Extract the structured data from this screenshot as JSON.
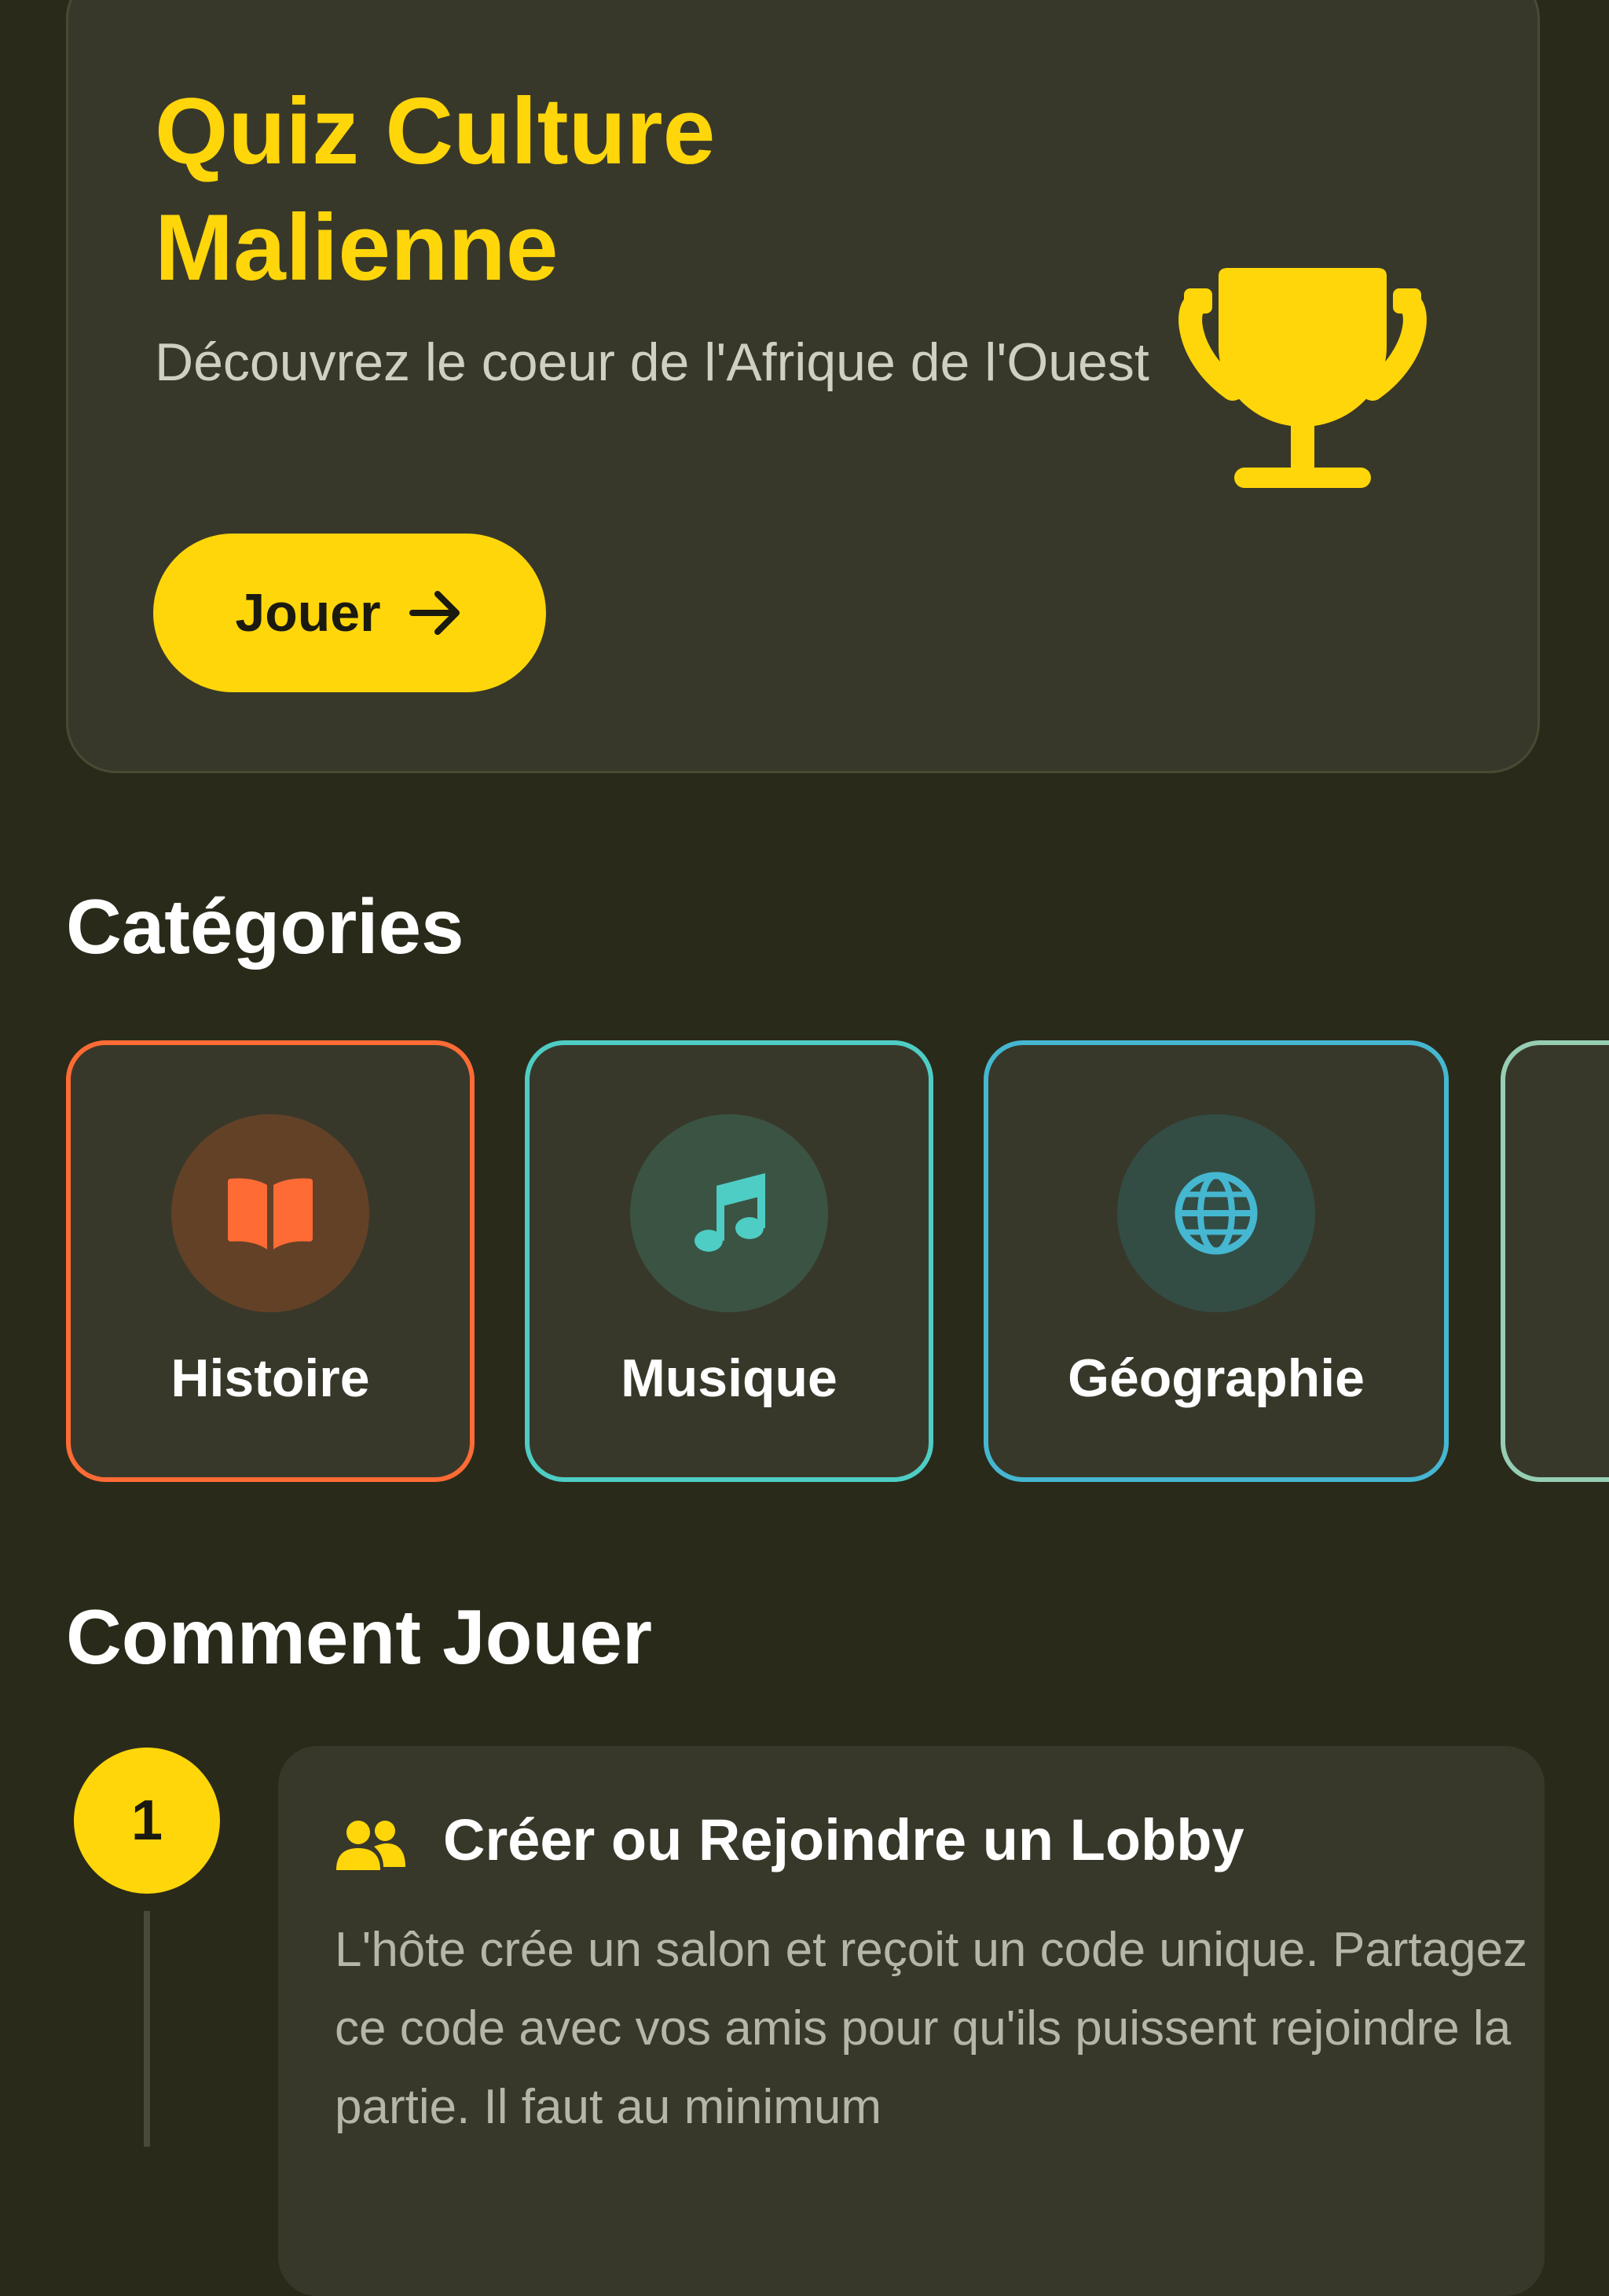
{
  "hero": {
    "title": "Quiz Culture Malienne",
    "subtitle": "Découvrez le coeur de l'Afrique de l'Ouest",
    "play_label": "Jouer",
    "trophy_icon": "trophy-icon",
    "arrow_icon": "arrow-right-icon"
  },
  "colors": {
    "background": "#2a2a1a",
    "card": "#38382a",
    "accent": "#ffd60a",
    "histoire": "#ff6b35",
    "musique": "#4ecdc4",
    "geographie": "#45b7d1",
    "fourth": "#96ceb4"
  },
  "categories": {
    "title": "Catégories",
    "items": [
      {
        "label": "Histoire",
        "icon": "book-icon"
      },
      {
        "label": "Musique",
        "icon": "music-note-icon"
      },
      {
        "label": "Géographie",
        "icon": "globe-icon"
      }
    ]
  },
  "how_to_play": {
    "title": "Comment Jouer",
    "steps": [
      {
        "number": "1",
        "icon": "users-icon",
        "title": "Créer ou Rejoindre un Lobby",
        "text": "L'hôte crée un salon et reçoit un code unique. Partagez ce code avec vos amis pour qu'ils puissent rejoindre la partie. Il faut au minimum"
      }
    ]
  }
}
